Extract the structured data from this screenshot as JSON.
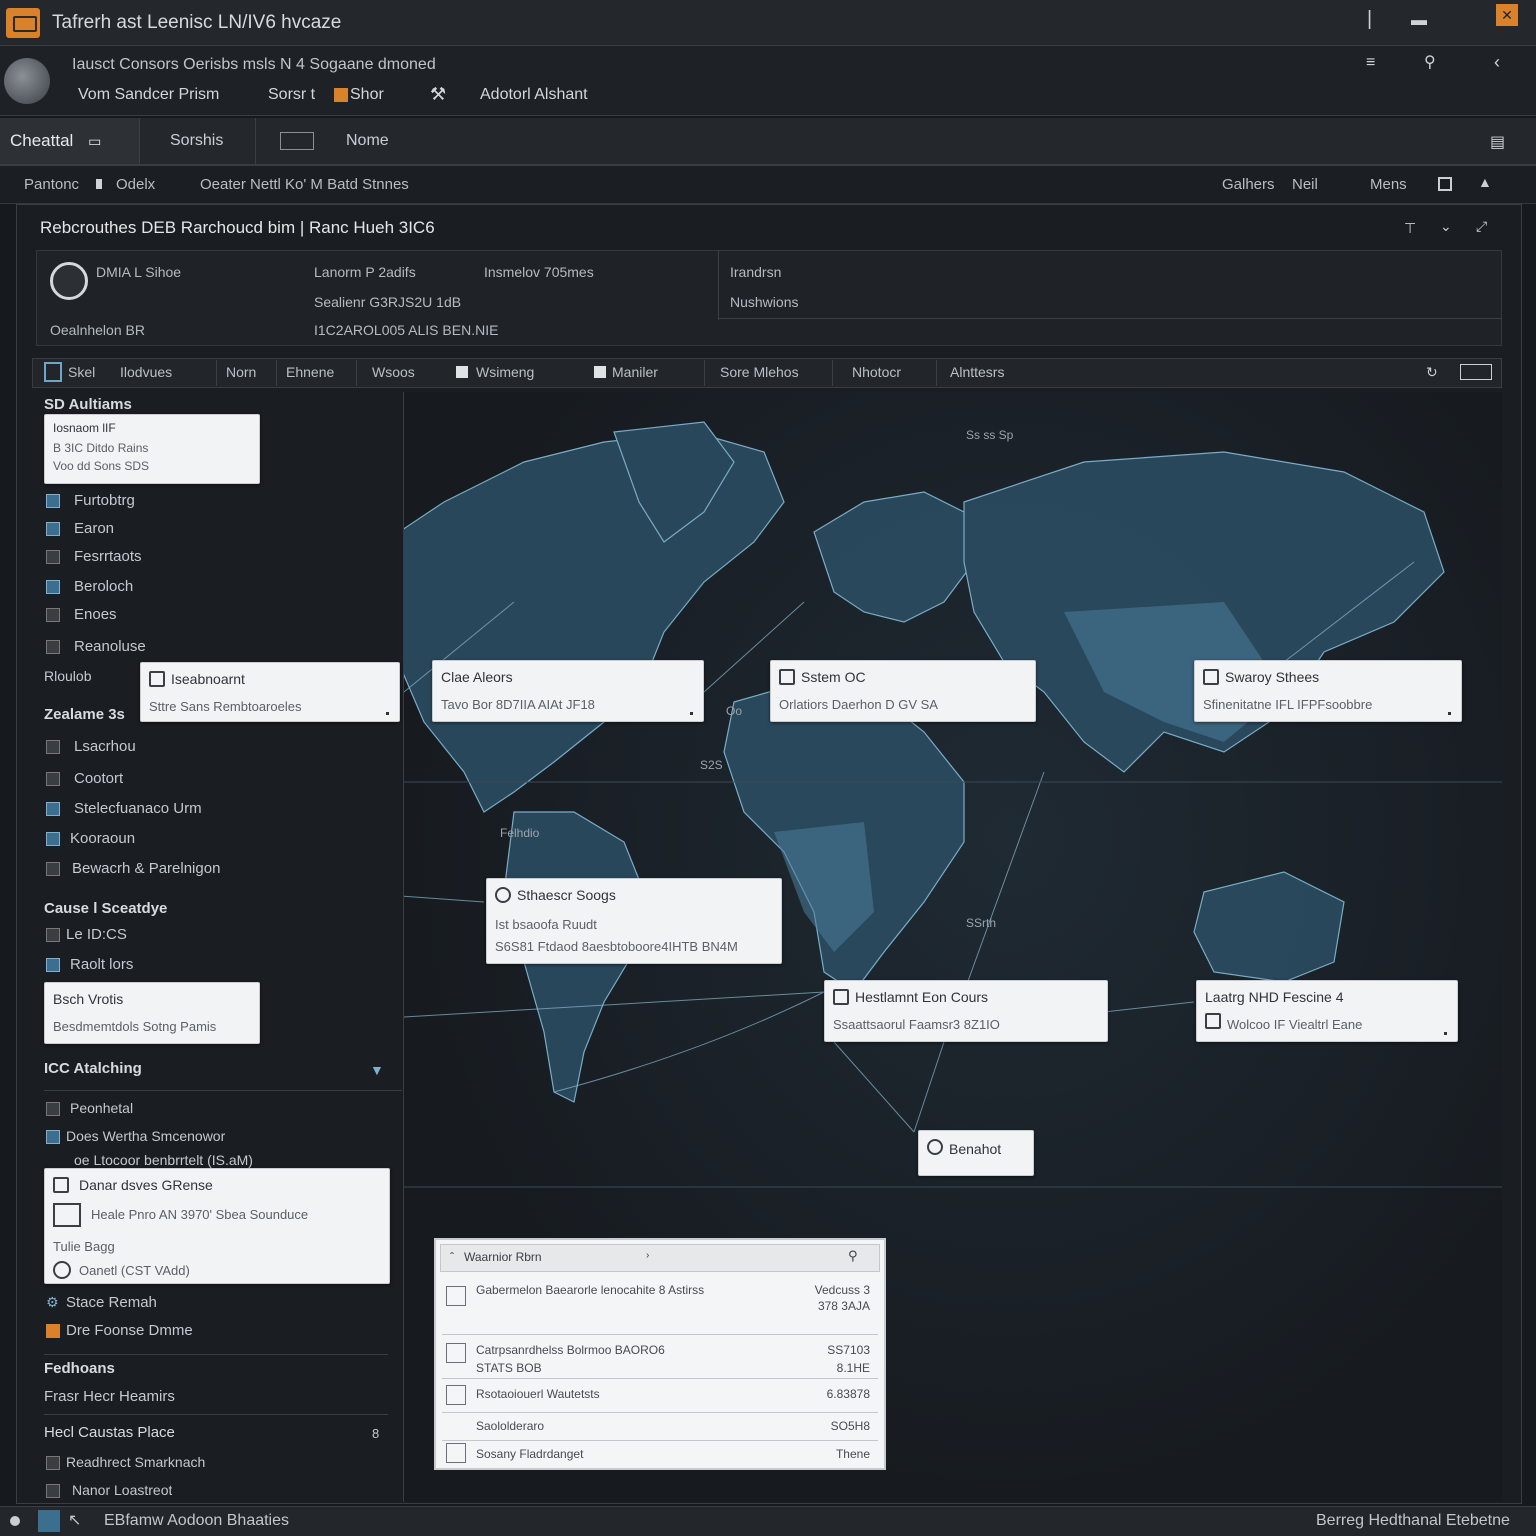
{
  "window": {
    "title": "Tafrerh ast Leenisc LN/IV6 hvcaze",
    "controls": [
      "minimize-icon",
      "maximize-icon",
      "close-icon"
    ]
  },
  "header": {
    "subtitle": "Iausct Consors Oerisbs  msls N 4  Sogaane dmoned",
    "links": [
      "Vom Sandcer Prism",
      "Sorsr t",
      "Shor",
      "Adotorl Alshant"
    ]
  },
  "tabs": [
    "Cheattal",
    "Sorshis",
    "Nome"
  ],
  "breadcrumb": {
    "left": [
      "Pantonc",
      "Odelx",
      "Oeater Nettl Ko' M Batd Stnnes"
    ],
    "right": [
      "Galhers",
      "Neil",
      "Mens"
    ]
  },
  "panel": {
    "title": "Rebcrouthes  DEB  Rarchoucd bim |  Ranc  Hueh 3IC6",
    "summary": {
      "name": "DMIA L Sihoe",
      "org": "Oealnhelon BR",
      "col2_line1": "Lanorm P 2adifs",
      "col2_line2": "Sealienr G3RJS2U 1dB",
      "col2_line3": "I1C2AROL005 ALIS BEN.NIE",
      "col3_line1": "Insmelov 705mes",
      "right_line1": "Irandrsn",
      "right_line2": "Nushwions"
    }
  },
  "toolbar": [
    "Skel",
    "Ilodvues",
    "Norn",
    "Ehnene",
    "Wsoos",
    "Wsimeng",
    "Maniler",
    "Sore Mlehos",
    "Nhotocr",
    "Alnttesrs"
  ],
  "sidebar": {
    "section1": "SD Aultiams",
    "card1": {
      "line1": "Iosnaom lIF",
      "line2": "B 3IC Ditdo Rains",
      "line3": "Voo dd Sons SDS"
    },
    "items1": [
      "Furtobtrg",
      "Earon",
      "Fesrrtaots",
      "Beroloch",
      "Enoes",
      "Reanoluse"
    ],
    "label_mid": "Rloulob",
    "section2": "Zealame 3s",
    "items2": [
      "Lsacrhou",
      "Cootort",
      "Stelecfuanaco Urm",
      "Kooraoun",
      "Bewacrh & Parelnigon"
    ],
    "section3": "Cause l Sceatdye",
    "items3": [
      "Le ID:CS",
      "Raolt lors"
    ],
    "card2": {
      "line1": "Bsch Vrotis",
      "line2": "Besdmemtdols Sotng Pamis"
    },
    "section4": "ICC Atalching",
    "items4": [
      "Peonhetal",
      "Does Wertha Smcenowor",
      "oe Ltocoor benbrrtelt (IS.aM)"
    ],
    "card3": {
      "line1": "Danar dsves GRense",
      "line2": "Heale Pnro AN 3970' Sbea Sounduce",
      "line3": "Tulie Bagg",
      "line4": "Oanetl (CST VAdd)"
    },
    "items5": [
      "Stace Remah",
      "Dre Foonse Dmme"
    ],
    "section5": "Fedhoans",
    "sub5": "Frasr Hecr Heamirs",
    "section6": "Hecl Caustas Place",
    "section6_count": "8",
    "items6": [
      "Readhrect Smarknach",
      "Nanor Loastreot"
    ]
  },
  "map": {
    "labels": [
      "Oo",
      "S2S",
      "Felhdio",
      "SSrth",
      "Ss ss Sp"
    ],
    "cards": [
      {
        "line1": "Iseabnoarnt",
        "line2": "Sttre Sans Rembtoaroeles"
      },
      {
        "line1": "Clae Aleors",
        "line2": "Tavo  Bor 8D7IIA AIAt JF18"
      },
      {
        "line1": "Sstem OC",
        "line2": "Orlatiors Daerhon D GV SA"
      },
      {
        "line1": "Swaroy Sthees",
        "line2": "Sfinenitatne IFL IFPFsoobbre"
      },
      {
        "line1": "Sthaescr Soogs",
        "line2": "Ist bsaoofa Ruudt",
        "line3": "S6S81 Ftdaod 8aesbtoboore4IHTB BN4M"
      },
      {
        "line1": "Hestlamnt Eon Cours",
        "line2": "Ssaattsaorul Faamsr3 8Z1IO"
      },
      {
        "line1": "Laatrg NHD Fescine 4",
        "line2": "Wolcoo IF Viealtrl Eane"
      },
      {
        "line1": "Benahot"
      }
    ]
  },
  "data_table": {
    "header": "Waarnior Rbrn",
    "rows": [
      {
        "name": "Gabermelon Baearorle  lenocahite 8 Astirss",
        "value": "Vedcuss 3 378 3AJA"
      },
      {
        "name": "Catrpsanrdhelss Bolrmoo BAORO6 STATS BOB",
        "value": "SS7103 8.1HE"
      },
      {
        "name": "Rsotaoiouerl Wautetsts",
        "value": "6.83878"
      },
      {
        "name": "Saololderaro",
        "value": "SO5H8"
      },
      {
        "name": "Sosany Fladrdanget",
        "value": "Thene"
      }
    ]
  },
  "statusbar": {
    "left": "EBfamw Aodoon Bhaaties",
    "right": "Berreg Hedthanal Etebetne"
  },
  "colors": {
    "accent": "#d9822b",
    "map_fill": "#4a7d9a",
    "background": "#16191d"
  }
}
